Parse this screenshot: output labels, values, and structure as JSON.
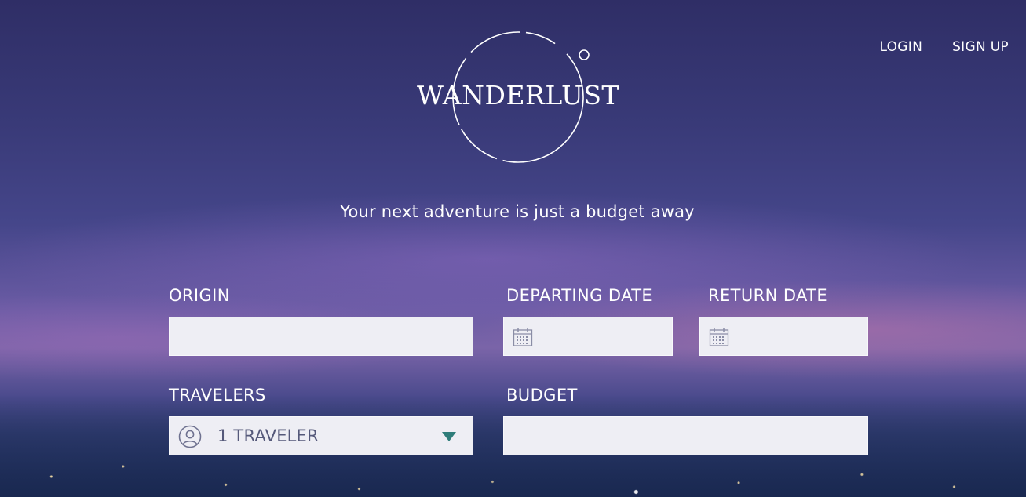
{
  "nav": {
    "login_label": "LOGIN",
    "signup_label": "SIGN UP"
  },
  "brand": {
    "logo_text": "WANDERLUST"
  },
  "tagline": "Your next adventure is just a budget away",
  "form": {
    "origin": {
      "label": "ORIGIN",
      "value": "",
      "placeholder": ""
    },
    "departing_date": {
      "label": "DEPARTING DATE",
      "value": "",
      "icon": "calendar-icon"
    },
    "return_date": {
      "label": "RETURN DATE",
      "value": "",
      "icon": "calendar-icon"
    },
    "travelers": {
      "label": "TRAVELERS",
      "selected": "1 TRAVELER",
      "icon": "person-icon",
      "dropdown_icon": "caret-down-icon"
    },
    "budget": {
      "label": "BUDGET",
      "value": ""
    }
  },
  "colors": {
    "accent": "#2f7d7a",
    "field_bg": "#eeeef4",
    "text_on_bg": "#ffffff"
  }
}
